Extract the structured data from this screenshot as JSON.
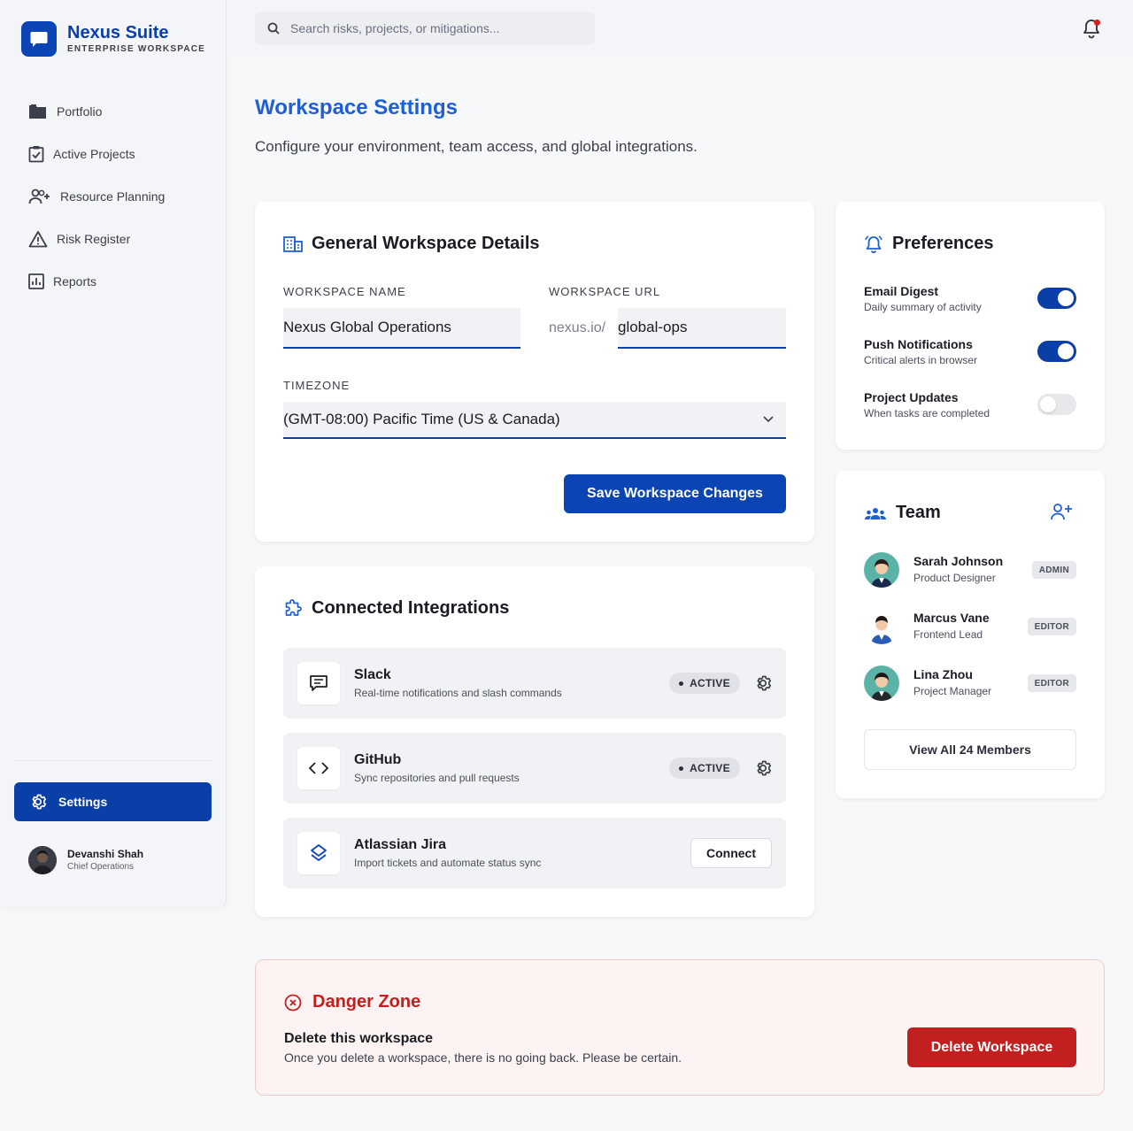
{
  "brand": {
    "title": "Nexus Suite",
    "subtitle": "ENTERPRISE WORKSPACE"
  },
  "nav": {
    "items": [
      {
        "label": "Portfolio",
        "icon": "folder-icon"
      },
      {
        "label": "Active Projects",
        "icon": "clipboard-check-icon"
      },
      {
        "label": "Resource Planning",
        "icon": "user-plus-icon"
      },
      {
        "label": "Risk Register",
        "icon": "warning-icon"
      },
      {
        "label": "Reports",
        "icon": "bar-chart-icon"
      }
    ],
    "settings_label": "Settings"
  },
  "user": {
    "name": "Devanshi Shah",
    "role": "Chief Operations"
  },
  "search": {
    "placeholder": "Search risks, projects, or mitigations..."
  },
  "page": {
    "title": "Workspace Settings",
    "subtitle": "Configure your environment, team access, and global integrations."
  },
  "general": {
    "title": "General Workspace Details",
    "name_label": "WORKSPACE NAME",
    "name_value": "Nexus Global Operations",
    "url_label": "WORKSPACE URL",
    "url_prefix": "nexus.io/",
    "url_value": "global-ops",
    "timezone_label": "TIMEZONE",
    "timezone_value": "(GMT-08:00) Pacific Time (US & Canada)",
    "save_label": "Save Workspace Changes"
  },
  "integrations": {
    "title": "Connected Integrations",
    "items": [
      {
        "name": "Slack",
        "desc": "Real-time notifications and slash commands",
        "status": "ACTIVE"
      },
      {
        "name": "GitHub",
        "desc": "Sync repositories and pull requests",
        "status": "ACTIVE"
      },
      {
        "name": "Atlassian Jira",
        "desc": "Import tickets and automate status sync",
        "action": "Connect"
      }
    ]
  },
  "preferences": {
    "title": "Preferences",
    "items": [
      {
        "title": "Email Digest",
        "desc": "Daily summary of activity",
        "enabled": true
      },
      {
        "title": "Push Notifications",
        "desc": "Critical alerts in browser",
        "enabled": true
      },
      {
        "title": "Project Updates",
        "desc": "When tasks are completed",
        "enabled": false
      }
    ]
  },
  "team": {
    "title": "Team",
    "members": [
      {
        "name": "Sarah Johnson",
        "role": "Product Designer",
        "badge": "ADMIN"
      },
      {
        "name": "Marcus Vane",
        "role": "Frontend Lead",
        "badge": "EDITOR"
      },
      {
        "name": "Lina Zhou",
        "role": "Project Manager",
        "badge": "EDITOR"
      }
    ],
    "view_all_label": "View All 24 Members"
  },
  "danger": {
    "title": "Danger Zone",
    "heading": "Delete this workspace",
    "text": "Once you delete a workspace, there is no going back. Please be certain.",
    "button_label": "Delete Workspace"
  },
  "colors": {
    "primary": "#0b3fa8",
    "accent": "#1e5fd6",
    "danger": "#c21f1f"
  }
}
